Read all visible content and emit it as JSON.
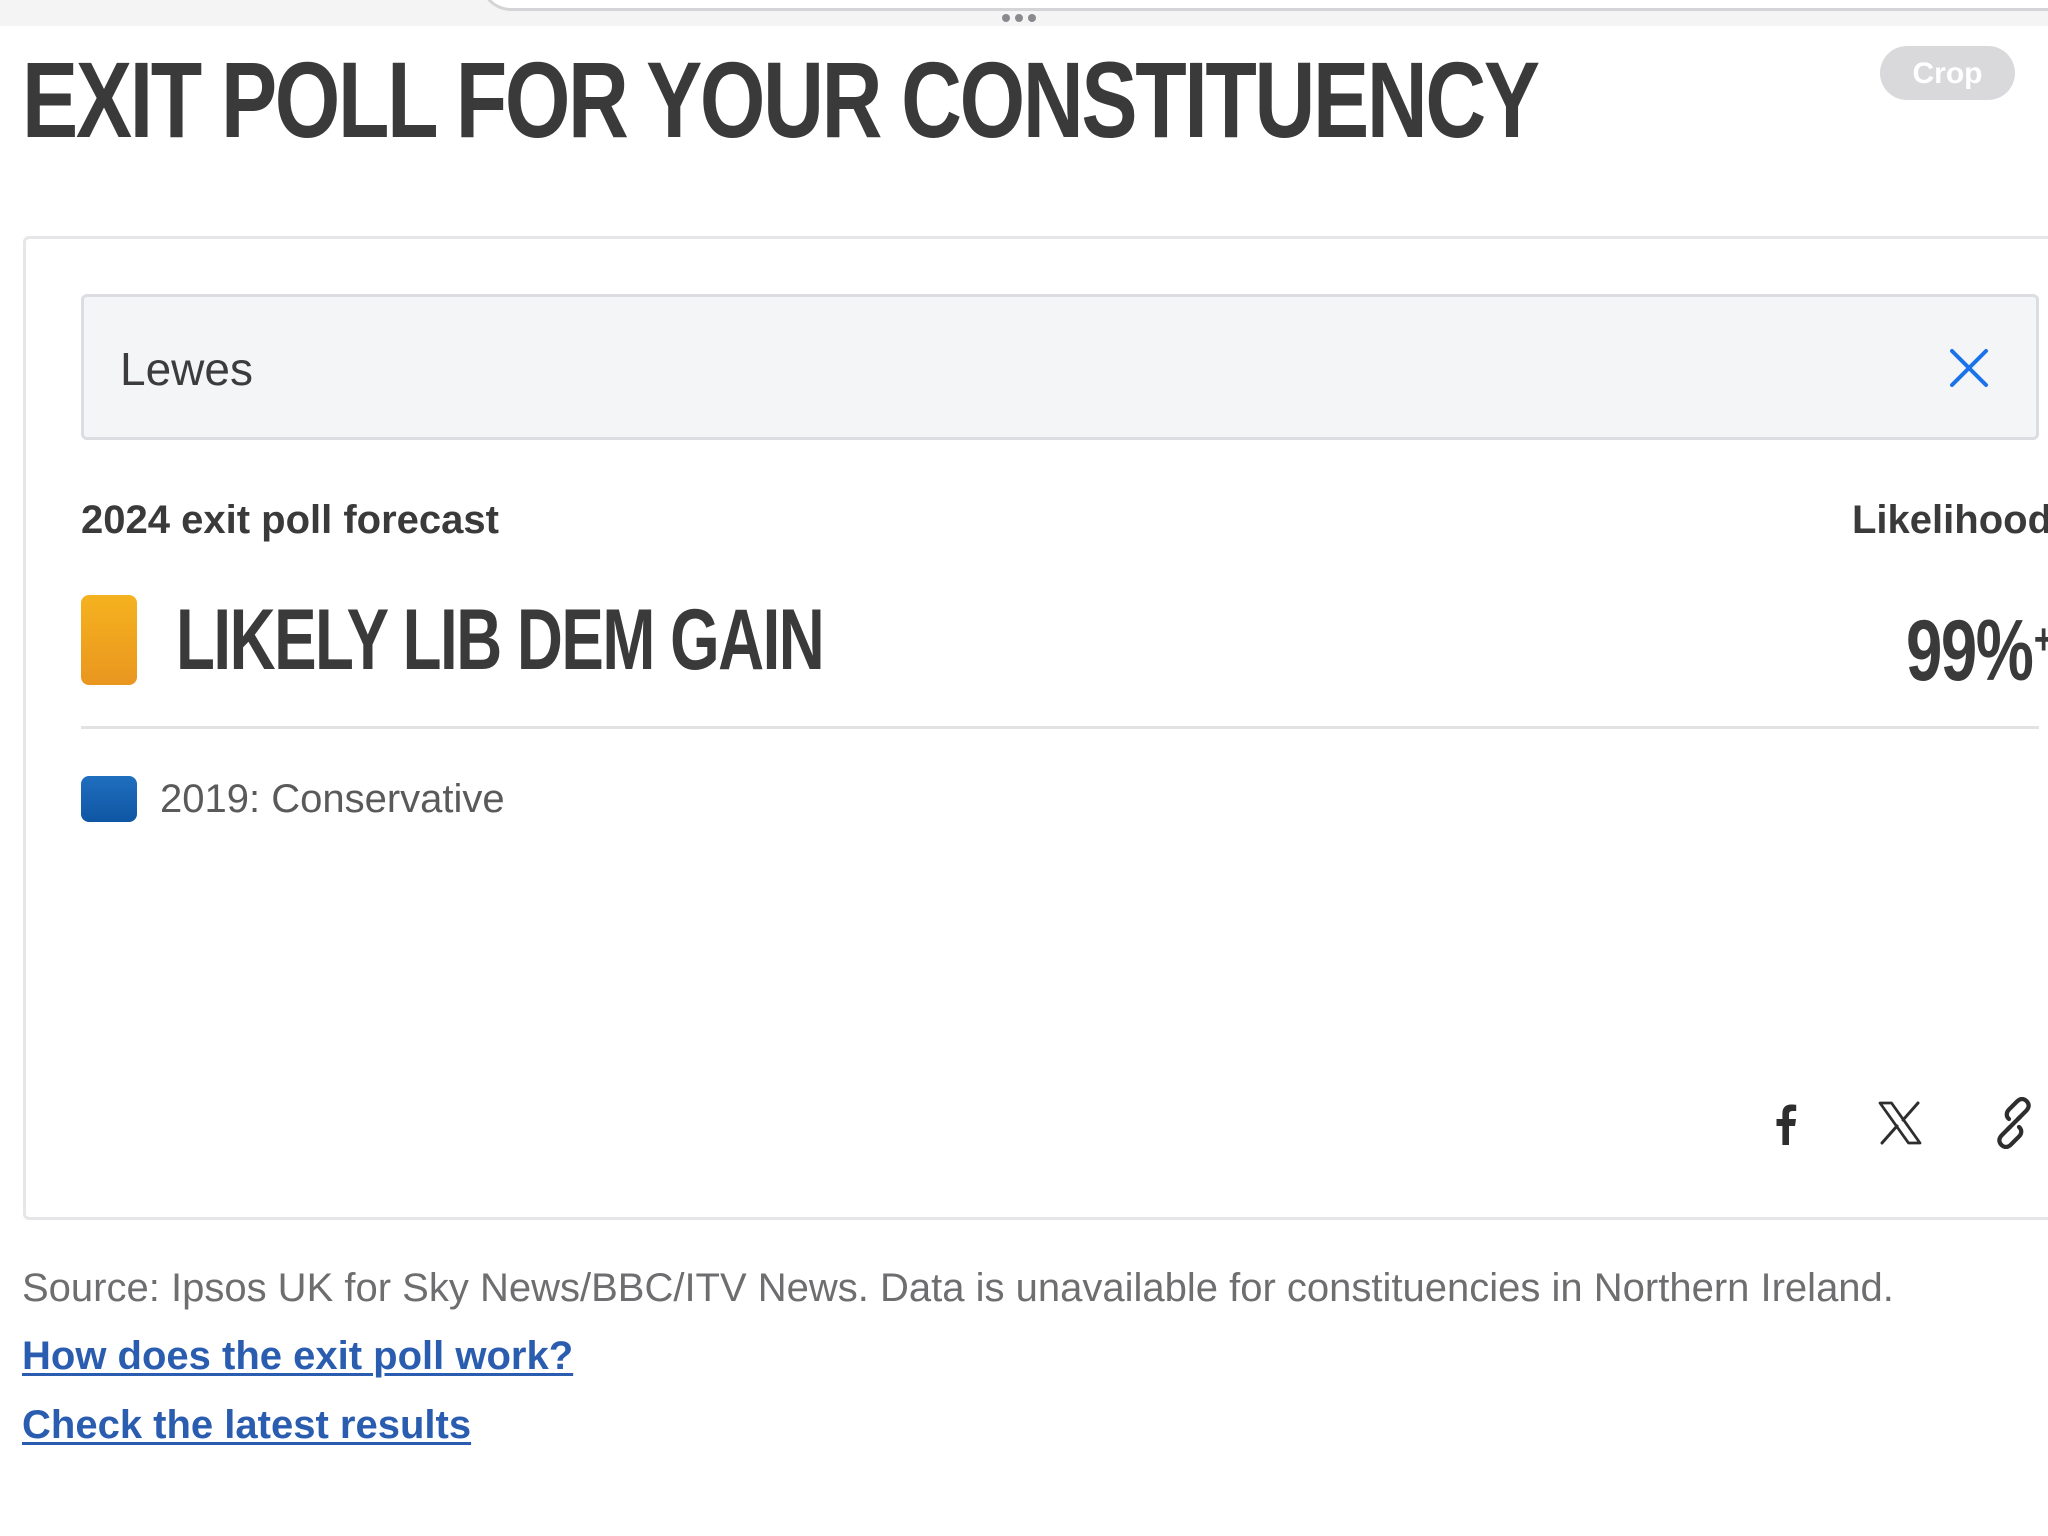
{
  "header": {
    "title": "EXIT POLL FOR YOUR CONSTITUENCY",
    "crop_label": "Crop"
  },
  "search": {
    "value": "Lewes",
    "clear_icon": "close-icon",
    "accent_color": "#1a73e8"
  },
  "forecast": {
    "label": "2024 exit poll forecast",
    "likelihood_label": "Likelihood",
    "result": "LIKELY LIB DEM GAIN",
    "likelihood_value": "99%",
    "likelihood_suffix": "+",
    "party_color": "#f0a51f"
  },
  "previous": {
    "result": "2019: Conservative",
    "party_color": "#1462ae"
  },
  "share": {
    "icons": [
      "facebook-icon",
      "x-icon",
      "link-icon"
    ]
  },
  "footer": {
    "source": "Source: Ipsos UK for Sky News/BBC/ITV News. Data is unavailable for constituencies in Northern Ireland.",
    "link_how": "How does the exit poll work?",
    "link_results": "Check the latest results"
  }
}
